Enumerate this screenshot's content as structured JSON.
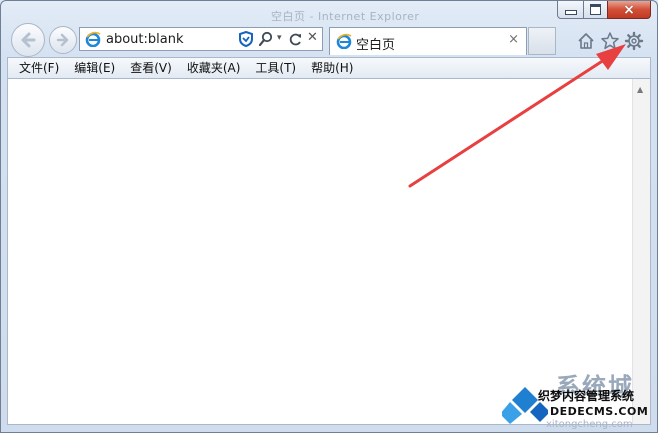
{
  "window": {
    "title": "空白页 - Internet Explorer",
    "caption_buttons": {
      "minimize": "minimize",
      "maximize": "maximize",
      "close": "×"
    }
  },
  "nav": {
    "back_icon": "back-arrow-icon",
    "forward_icon": "forward-arrow-icon"
  },
  "address_bar": {
    "value": "about:blank",
    "icons": [
      "ie-logo-icon",
      "shield-icon",
      "search-icon",
      "dropdown-icon",
      "refresh-icon",
      "stop-icon"
    ],
    "dropdown_glyph": "▾",
    "stop_glyph": "✕"
  },
  "tab": {
    "title": "空白页",
    "close_glyph": "×"
  },
  "toolbar_icons": [
    "home-icon",
    "favorites-star-icon",
    "tools-gear-icon"
  ],
  "menu": {
    "items": [
      "文件(F)",
      "编辑(E)",
      "查看(V)",
      "收藏夹(A)",
      "工具(T)",
      "帮助(H)"
    ]
  },
  "content": {
    "scroll_up_glyph": "▲"
  },
  "annotation": {
    "type": "arrow",
    "color": "#e84040",
    "points_to": "tools-gear-icon"
  },
  "watermark": {
    "big_text": "系统城",
    "line1": "织梦内容管理系统",
    "line2": "DEDECMS.COM",
    "site": "xitongcheng.com"
  },
  "colors": {
    "accent_ie": "#1e88d8",
    "close_red": "#c8452c",
    "arrow_red": "#e84040"
  }
}
